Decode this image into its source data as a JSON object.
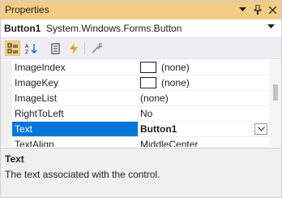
{
  "window": {
    "title": "Properties",
    "pin_icon": "pin-icon",
    "dropdown_icon": "chevron-down-icon",
    "close_icon": "close-icon"
  },
  "object_selector": {
    "name": "Button1",
    "type": "System.Windows.Forms.Button"
  },
  "toolbar": {
    "buttons": [
      {
        "icon": "categorized-icon",
        "active": true
      },
      {
        "icon": "alphabetical-icon",
        "active": false
      },
      {
        "icon": "properties-icon",
        "active": false
      },
      {
        "icon": "events-icon",
        "active": false
      },
      {
        "icon": "property-pages-icon",
        "active": false
      }
    ]
  },
  "properties": [
    {
      "name": "ImageIndex",
      "value": "(none)",
      "swatch": true
    },
    {
      "name": "ImageKey",
      "value": "(none)",
      "swatch": true
    },
    {
      "name": "ImageList",
      "value": "(none)",
      "swatch": false
    },
    {
      "name": "RightToLeft",
      "value": "No",
      "swatch": false
    },
    {
      "name": "Text",
      "value": "Button1",
      "swatch": false,
      "selected": true
    },
    {
      "name": "TextAlign",
      "value": "MiddleCenter",
      "swatch": false
    }
  ],
  "description": {
    "title": "Text",
    "text": "The text associated with the control."
  },
  "colors": {
    "title_bar": "#f5cc84",
    "selection": "#0078d7"
  }
}
